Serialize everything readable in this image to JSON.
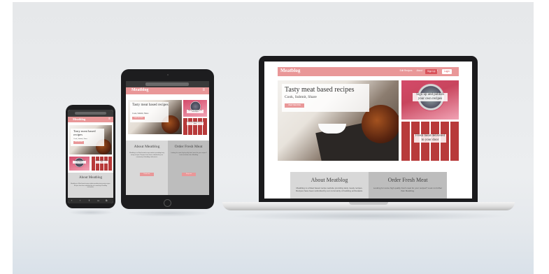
{
  "site": {
    "logo": "Meatblog",
    "nav_links": [
      "Edit Recipes",
      "About",
      "Fresh Meat"
    ],
    "signup_label": "Sign Up",
    "login_label": "Login",
    "menu_icon": "hamburger-menu-icon"
  },
  "hero": {
    "title": "Tasty meat based recipes",
    "subtitle": "Cook, Submit, Share",
    "cta_label": "VIEW RECIPES"
  },
  "tiles": {
    "signup_caption": "Sign up and publish your own recipes",
    "fresh_caption": "Fresh meat delivered to your door"
  },
  "about": {
    "heading": "About Meatblog",
    "text": "Meatblog is a Meat based recipe website providing tasty meaty recipes. Recipes have been submitted by our community of budding enthusiasts.",
    "button_label": "Read more"
  },
  "order": {
    "heading": "Order Fresh Meat",
    "text": "Looking for some high quality fresh meat for your recipes? Look no further than Meatblog.",
    "button_label": "Shop now"
  },
  "phone": {
    "bottom_bar_icons": [
      "back-icon",
      "forward-icon",
      "share-icon",
      "book-icon",
      "tabs-icon"
    ],
    "bottom_bar_glyphs": [
      "‹",
      "›",
      "⇧",
      "▭",
      "⧉"
    ]
  },
  "colors": {
    "brand_pink": "#e99798",
    "about_grey": "#d8d8d8",
    "order_grey": "#bdbdbd"
  }
}
